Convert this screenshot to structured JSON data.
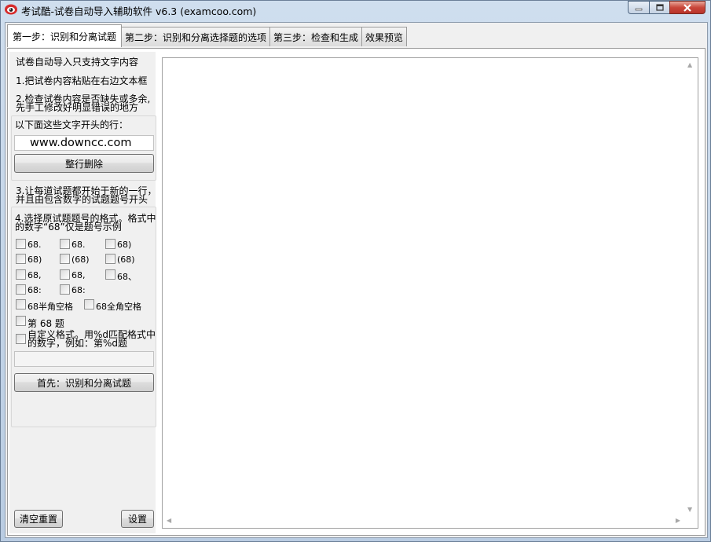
{
  "window": {
    "title": "考试酷-试卷自动导入辅助软件 v6.3 (examcoo.com)"
  },
  "tabs": [
    {
      "label": "第一步：识别和分离试题"
    },
    {
      "label": "第二步：识别和分离选择题的选项"
    },
    {
      "label": "第三步：检查和生成"
    },
    {
      "label": "效果预览"
    }
  ],
  "panel": {
    "notice": "试卷自动导入只支持文字内容",
    "step1": "1.把试卷内容粘贴在右边文本框",
    "step2_line1": "2.检查试卷内容是否缺失或多余,",
    "step2_line2": "先手工修改好明显错误的地方",
    "delete_prefix_label": "以下面这些文字开头的行：",
    "delete_prefix_value": "www.downcc.com",
    "delete_button": "整行删除",
    "step3_line1": "3.让每道试题都开始于新的一行，",
    "step3_line2": "并且由包含数字的试题题号开头",
    "step4_line1": "4.选择原试题题号的格式。格式中",
    "step4_line2": "的数字“68”仅是题号示例",
    "formats": [
      "68.",
      "68.",
      "68)",
      "68)",
      "(68)",
      "(68)",
      "68,",
      "68,",
      "68、",
      "68:",
      "68:"
    ],
    "half_space": "68半角空格",
    "full_space": "68全角空格",
    "di_ti": "第 68 题",
    "custom_line1": "自定义格式。用%d匹配格式中",
    "custom_line2": "的数字，例如：第%d题",
    "custom_value": "",
    "start_button": "首先：识别和分离试题",
    "clear_button": "清空重置",
    "settings_button": "设置"
  },
  "editor": {
    "content": ""
  },
  "icons": {
    "app": "eye-logo-icon",
    "minimize": "minimize-icon",
    "maximize": "maximize-icon",
    "close": "close-icon"
  },
  "colors": {
    "title_bar": "#c8d6e6",
    "close_button": "#c9473a",
    "panel_bg": "#f0f0f0"
  }
}
